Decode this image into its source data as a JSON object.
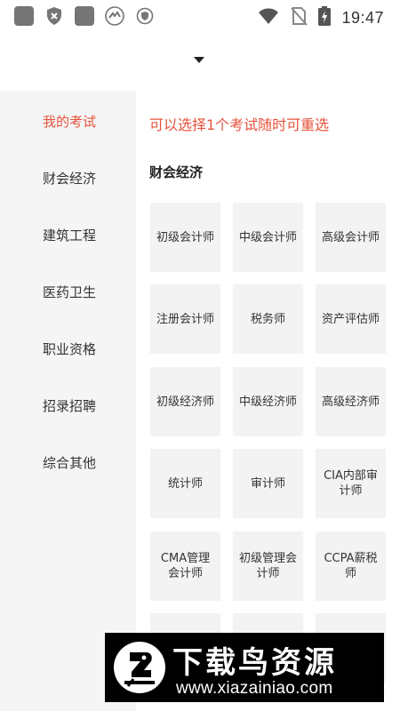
{
  "status_bar": {
    "time": "19:47",
    "left_icons": [
      "app-square-icon",
      "shield-x-icon",
      "app-square-icon",
      "bird-app-icon",
      "shield-check-icon"
    ],
    "right_icons": [
      "wifi-icon",
      "no-sim-icon",
      "battery-charging-icon"
    ]
  },
  "sidebar": {
    "items": [
      {
        "label": "我的考试",
        "active": true
      },
      {
        "label": "财会经济",
        "active": false
      },
      {
        "label": "建筑工程",
        "active": false
      },
      {
        "label": "医药卫生",
        "active": false
      },
      {
        "label": "职业资格",
        "active": false
      },
      {
        "label": "招录招聘",
        "active": false
      },
      {
        "label": "综合其他",
        "active": false
      }
    ]
  },
  "main": {
    "hint": "可以选择1个考试随时可重选",
    "section_title": "财会经济",
    "cards": [
      "初级会计师",
      "中级会计师",
      "高级会计师",
      "注册会计师",
      "税务师",
      "资产评估师",
      "初级经济师",
      "中级经济师",
      "高级经济师",
      "统计师",
      "审计师",
      "CIA内部审计师",
      "CMA管理会计师",
      "初级管理会计师",
      "CCPA薪税师",
      "",
      "",
      ""
    ]
  },
  "banner": {
    "title": "下载鸟资源",
    "url": "www.xiazainiao.com"
  },
  "colors": {
    "accent": "#e6533c",
    "sidebar_bg": "#f5f5f5",
    "card_bg": "#f3f3f3"
  }
}
